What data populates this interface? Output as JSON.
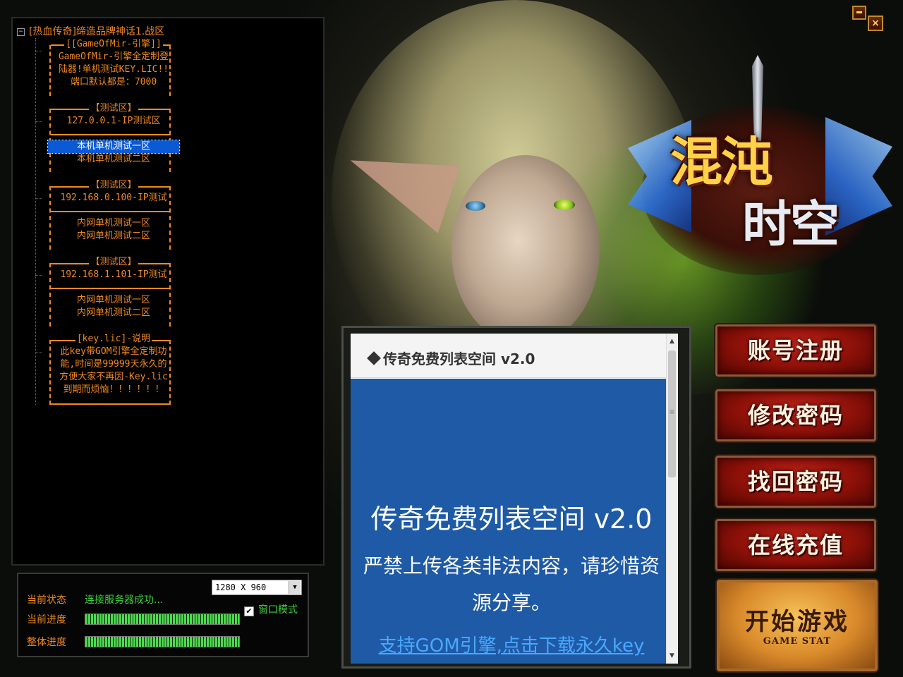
{
  "window": {
    "close_symbol": "×"
  },
  "tree": {
    "root_label": "[热血传奇]缔造品牌神话1.战区",
    "toggle": "−",
    "info_block": [
      "[[GameOfMir-引擎]]",
      "GameOfMir-引擎全定制登",
      "陆器!单机测试KEY.LIC!!",
      "端口默认都是：7000"
    ],
    "groups": [
      {
        "header": "【测试区】",
        "subtitle": "127.0.0.1-IP测试区",
        "items": [
          "本机单机测试一区",
          "本机单机测试二区"
        ],
        "selected": 0
      },
      {
        "header": "【测试区】",
        "subtitle": "192.168.0.100-IP测试",
        "items": [
          "内网单机测试一区",
          "内网单机测试二区"
        ]
      },
      {
        "header": "【测试区】",
        "subtitle": "192.168.1.101-IP测试",
        "items": [
          "内网单机测试一区",
          "内网单机测试二区"
        ]
      }
    ],
    "key_block": [
      "[key.lic]-说明",
      "此key带GOM引擎全定制功",
      "能,时间是99999天永久的",
      "方便大家不再因-Key.lic",
      "到期而烦恼！！！！！！"
    ]
  },
  "status": {
    "current_status_label": "当前状态",
    "current_status_value": "连接服务器成功...",
    "current_progress_label": "当前进度",
    "overall_progress_label": "整体进度",
    "current_progress": 1.0,
    "overall_progress": 1.0,
    "resolution": "1280 X 960",
    "window_mode_label": "窗口模式",
    "window_mode_checked": true
  },
  "notice": {
    "header_title": "传奇免费列表空间 v2.0",
    "title": "传奇免费列表空间 v2.0",
    "text": "严禁上传各类非法内容，请珍惜资源分享。",
    "link": "支持GOM引擎,点击下载永久key"
  },
  "logo": {
    "line1": "混沌",
    "line2": "时空"
  },
  "buttons": {
    "register": "账号注册",
    "change_password": "修改密码",
    "recover_password": "找回密码",
    "recharge": "在线充值",
    "start_game": "开始游戏",
    "start_game_sub": "GAME STAT"
  },
  "colors": {
    "accent_orange": "#f08a1e",
    "status_green": "#3cd23c",
    "button_red": "#8a1008",
    "start_gold": "#d8892a",
    "notice_blue": "#1e5aa6"
  }
}
